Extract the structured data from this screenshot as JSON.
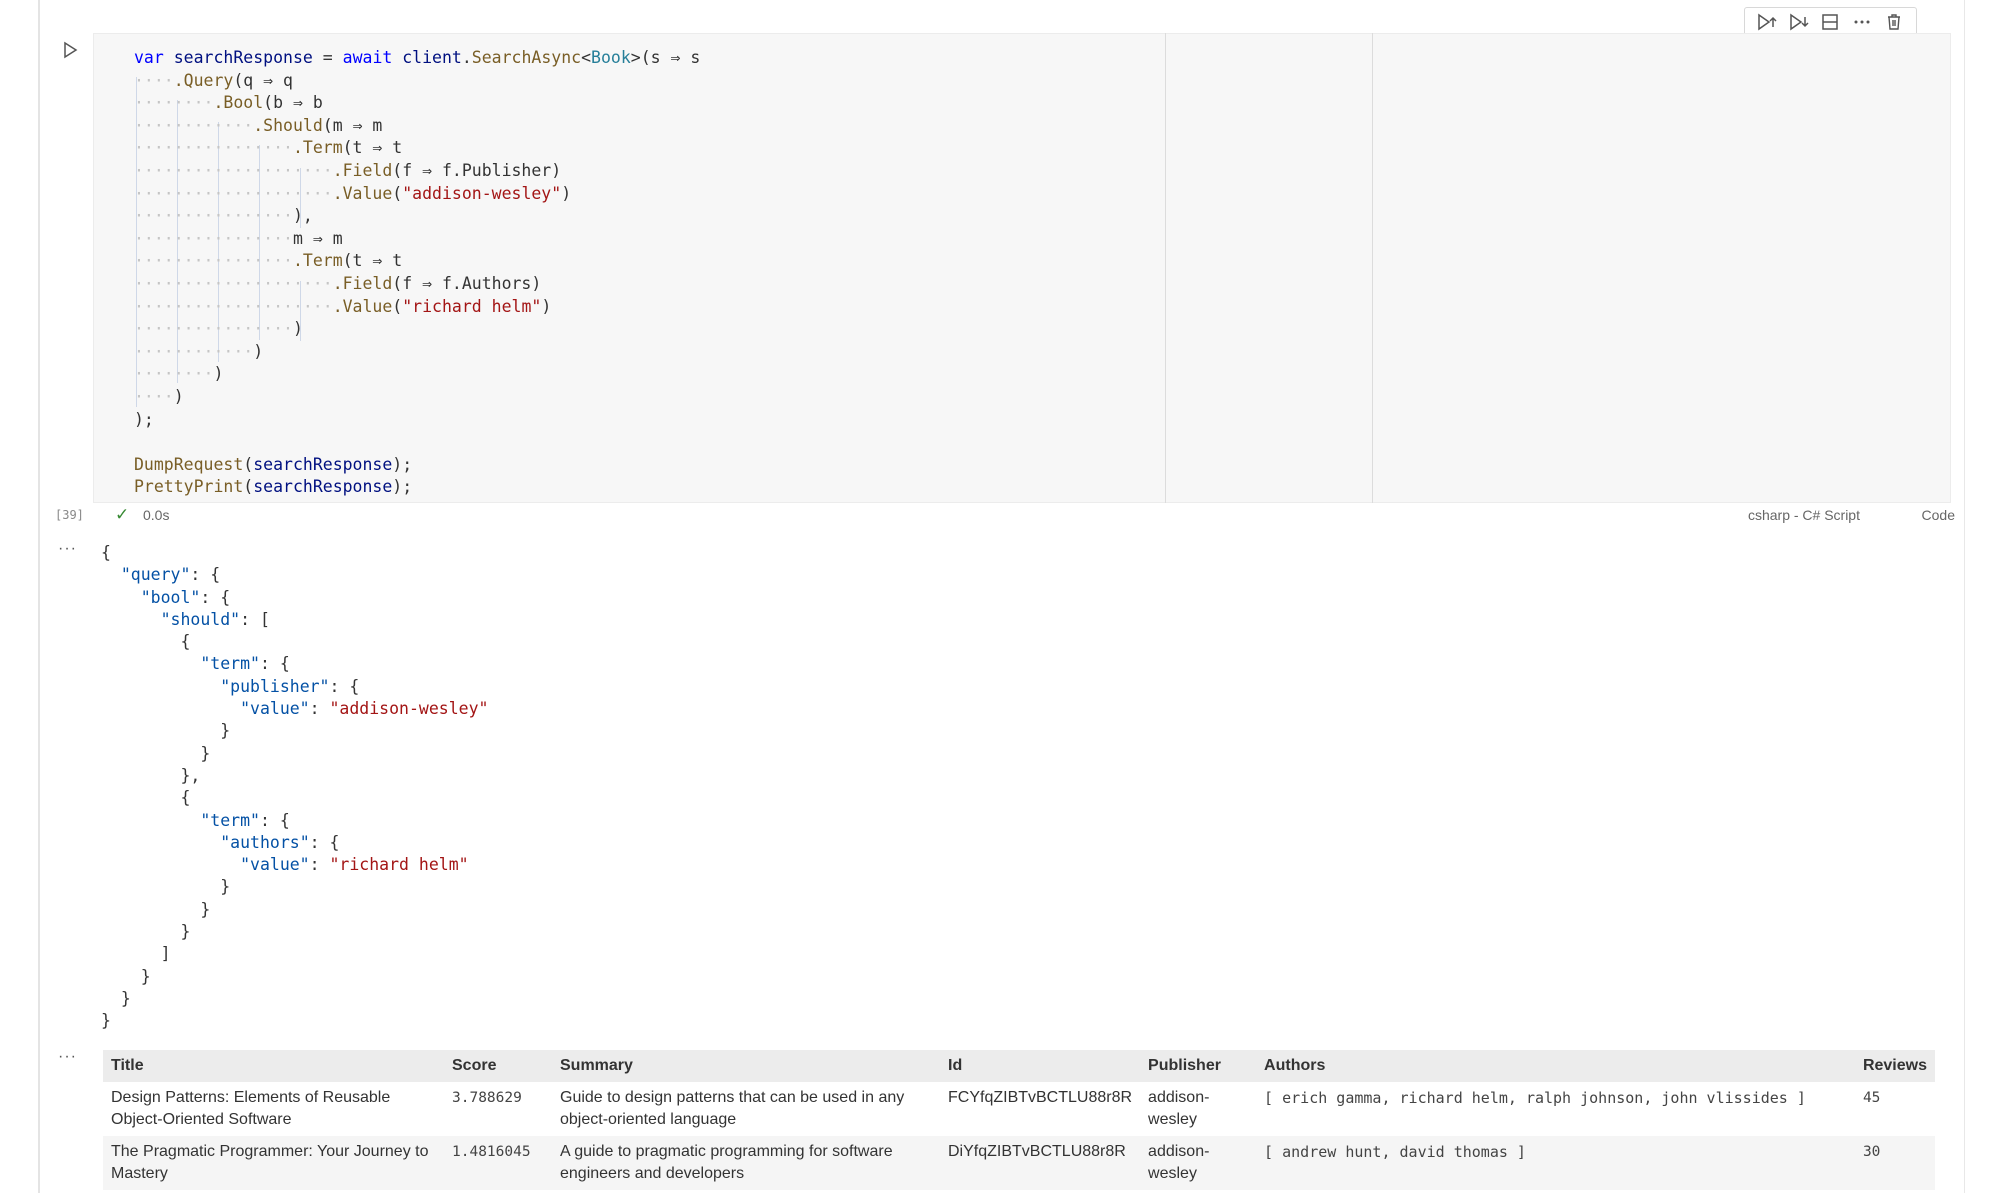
{
  "cell": {
    "exec_count": "[39]",
    "duration": "0.0s",
    "language": "csharp - C# Script",
    "cell_type": "Code",
    "code_lines": [
      [
        [
          "kw",
          "var"
        ],
        [
          "pn",
          " "
        ],
        [
          "vn",
          "searchResponse"
        ],
        [
          "pn",
          " = "
        ],
        [
          "kw",
          "await"
        ],
        [
          "pn",
          " "
        ],
        [
          "vn",
          "client"
        ],
        [
          "pn",
          "."
        ],
        [
          "me",
          "SearchAsync"
        ],
        [
          "pn",
          "<"
        ],
        [
          "ty",
          "Book"
        ],
        [
          "pn",
          ">(s ⇒ s"
        ]
      ],
      [
        [
          "ws",
          "····"
        ],
        [
          "me",
          ".Query"
        ],
        [
          "pn",
          "(q ⇒ q"
        ]
      ],
      [
        [
          "ws",
          "········"
        ],
        [
          "me",
          ".Bool"
        ],
        [
          "pn",
          "(b ⇒ b"
        ]
      ],
      [
        [
          "ws",
          "············"
        ],
        [
          "me",
          ".Should"
        ],
        [
          "pn",
          "(m ⇒ m"
        ]
      ],
      [
        [
          "ws",
          "················"
        ],
        [
          "me",
          ".Term"
        ],
        [
          "pn",
          "(t ⇒ t"
        ]
      ],
      [
        [
          "ws",
          "····················"
        ],
        [
          "me",
          ".Field"
        ],
        [
          "pn",
          "(f ⇒ f.Publisher)"
        ]
      ],
      [
        [
          "ws",
          "····················"
        ],
        [
          "me",
          ".Value"
        ],
        [
          "pn",
          "("
        ],
        [
          "st",
          "\"addison-wesley\""
        ],
        [
          "pn",
          ")"
        ]
      ],
      [
        [
          "ws",
          "················"
        ],
        [
          "pn",
          "),"
        ]
      ],
      [
        [
          "ws",
          "················"
        ],
        [
          "pn",
          "m ⇒ m"
        ]
      ],
      [
        [
          "ws",
          "················"
        ],
        [
          "me",
          ".Term"
        ],
        [
          "pn",
          "(t ⇒ t"
        ]
      ],
      [
        [
          "ws",
          "····················"
        ],
        [
          "me",
          ".Field"
        ],
        [
          "pn",
          "(f ⇒ f.Authors)"
        ]
      ],
      [
        [
          "ws",
          "····················"
        ],
        [
          "me",
          ".Value"
        ],
        [
          "pn",
          "("
        ],
        [
          "st",
          "\"richard helm\""
        ],
        [
          "pn",
          ")"
        ]
      ],
      [
        [
          "ws",
          "················"
        ],
        [
          "pn",
          ")"
        ]
      ],
      [
        [
          "ws",
          "············"
        ],
        [
          "pn",
          ")"
        ]
      ],
      [
        [
          "ws",
          "········"
        ],
        [
          "pn",
          ")"
        ]
      ],
      [
        [
          "ws",
          "····"
        ],
        [
          "pn",
          ")"
        ]
      ],
      [
        [
          "pn",
          ");"
        ]
      ],
      [],
      [
        [
          "me",
          "DumpRequest"
        ],
        [
          "pn",
          "("
        ],
        [
          "vn",
          "searchResponse"
        ],
        [
          "pn",
          ");"
        ]
      ],
      [
        [
          "me",
          "PrettyPrint"
        ],
        [
          "pn",
          "("
        ],
        [
          "vn",
          "searchResponse"
        ],
        [
          "pn",
          ");"
        ]
      ]
    ]
  },
  "output1": {
    "more": "···",
    "json_lines": [
      [
        [
          "jp",
          "{"
        ]
      ],
      [
        [
          "jp",
          "  "
        ],
        [
          "jk",
          "\"query\""
        ],
        [
          "jp",
          ": {"
        ]
      ],
      [
        [
          "jp",
          "    "
        ],
        [
          "jk",
          "\"bool\""
        ],
        [
          "jp",
          ": {"
        ]
      ],
      [
        [
          "jp",
          "      "
        ],
        [
          "jk",
          "\"should\""
        ],
        [
          "jp",
          ": ["
        ]
      ],
      [
        [
          "jp",
          "        {"
        ]
      ],
      [
        [
          "jp",
          "          "
        ],
        [
          "jk",
          "\"term\""
        ],
        [
          "jp",
          ": {"
        ]
      ],
      [
        [
          "jp",
          "            "
        ],
        [
          "jk",
          "\"publisher\""
        ],
        [
          "jp",
          ": {"
        ]
      ],
      [
        [
          "jp",
          "              "
        ],
        [
          "jk",
          "\"value\""
        ],
        [
          "jp",
          ": "
        ],
        [
          "jv",
          "\"addison-wesley\""
        ]
      ],
      [
        [
          "jp",
          "            }"
        ]
      ],
      [
        [
          "jp",
          "          }"
        ]
      ],
      [
        [
          "jp",
          "        },"
        ]
      ],
      [
        [
          "jp",
          "        {"
        ]
      ],
      [
        [
          "jp",
          "          "
        ],
        [
          "jk",
          "\"term\""
        ],
        [
          "jp",
          ": {"
        ]
      ],
      [
        [
          "jp",
          "            "
        ],
        [
          "jk",
          "\"authors\""
        ],
        [
          "jp",
          ": {"
        ]
      ],
      [
        [
          "jp",
          "              "
        ],
        [
          "jk",
          "\"value\""
        ],
        [
          "jp",
          ": "
        ],
        [
          "jv",
          "\"richard helm\""
        ]
      ],
      [
        [
          "jp",
          "            }"
        ]
      ],
      [
        [
          "jp",
          "          }"
        ]
      ],
      [
        [
          "jp",
          "        }"
        ]
      ],
      [
        [
          "jp",
          "      ]"
        ]
      ],
      [
        [
          "jp",
          "    }"
        ]
      ],
      [
        [
          "jp",
          "  }"
        ]
      ],
      [
        [
          "jp",
          "}"
        ]
      ]
    ]
  },
  "output2": {
    "more": "···",
    "columns": [
      "Title",
      "Score",
      "Summary",
      "Id",
      "Publisher",
      "Authors",
      "Reviews"
    ],
    "rows": [
      {
        "title": "Design Patterns: Elements of Reusable Object-Oriented Software",
        "score": "3.788629",
        "summary": "Guide to design patterns that can be used in any object-oriented language",
        "id": "FCYfqZIBTvBCTLU88r8R",
        "publisher": "addison-wesley",
        "authors": "[ erich gamma, richard helm, ralph johnson, john vlissides ]",
        "reviews": "45"
      },
      {
        "title": "The Pragmatic Programmer: Your Journey to Mastery",
        "score": "1.4816045",
        "summary": "A guide to pragmatic programming for software engineers and developers",
        "id": "DiYfqZIBTvBCTLU88r8R",
        "publisher": "addison-wesley",
        "authors": "[ andrew hunt, david thomas ]",
        "reviews": "30"
      }
    ]
  },
  "toolbar": {
    "icons": [
      "run-above-icon",
      "run-below-icon",
      "split-cell-icon",
      "more-actions-icon",
      "delete-cell-icon"
    ]
  }
}
